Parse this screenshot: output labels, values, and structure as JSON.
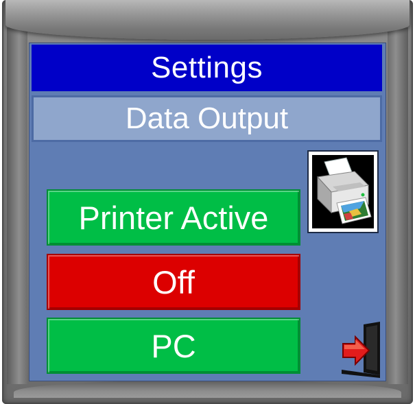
{
  "header": {
    "title": "Settings",
    "subtitle": "Data Output"
  },
  "options": [
    {
      "label": "Printer Active",
      "color": "#00be46"
    },
    {
      "label": "Off",
      "color": "#dc0000"
    },
    {
      "label": "PC",
      "color": "#00be46"
    }
  ],
  "icons": {
    "printer": "printer-icon",
    "exit": "exit-door-icon"
  },
  "colors": {
    "screen_bg": "#5f7db4",
    "title_bg": "#0000c8",
    "subtitle_bg": "#8fa6cc",
    "active_green": "#00be46",
    "inactive_red": "#dc0000"
  }
}
